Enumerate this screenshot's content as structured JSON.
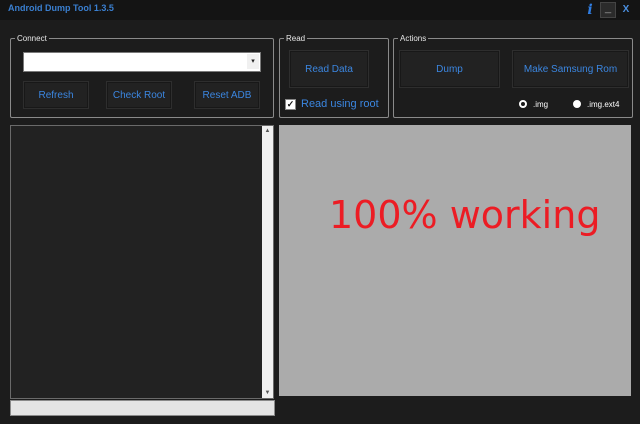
{
  "window": {
    "title": "Android Dump Tool 1.3.5"
  },
  "titlebar": {
    "info_glyph": "i",
    "minimize_glyph": "_",
    "close_glyph": "X"
  },
  "connect": {
    "legend": "Connect",
    "device_select": {
      "value": ""
    },
    "refresh_label": "Refresh",
    "check_root_label": "Check Root",
    "reset_adb_label": "Reset ADB"
  },
  "read": {
    "legend": "Read",
    "read_data_label": "Read Data",
    "read_using_root": {
      "label": "Read using root",
      "checked": true,
      "glyph": "✓"
    }
  },
  "actions": {
    "legend": "Actions",
    "dump_label": "Dump",
    "make_samsung_rom_label": "Make Samsung Rom",
    "format_options": [
      {
        "label": ".img",
        "selected": false
      },
      {
        "label": ".img.ext4",
        "selected": true
      }
    ]
  },
  "log": {
    "scroll_up_glyph": "▲",
    "scroll_down_glyph": "▼"
  },
  "progress": {
    "value": 0
  },
  "preview": {
    "overlay_text": "100% working",
    "overlay_color": "#ec1c24"
  },
  "colors": {
    "accent": "#3b86e0",
    "window_bg": "#1c1c1c",
    "preview_bg": "#ababab"
  }
}
